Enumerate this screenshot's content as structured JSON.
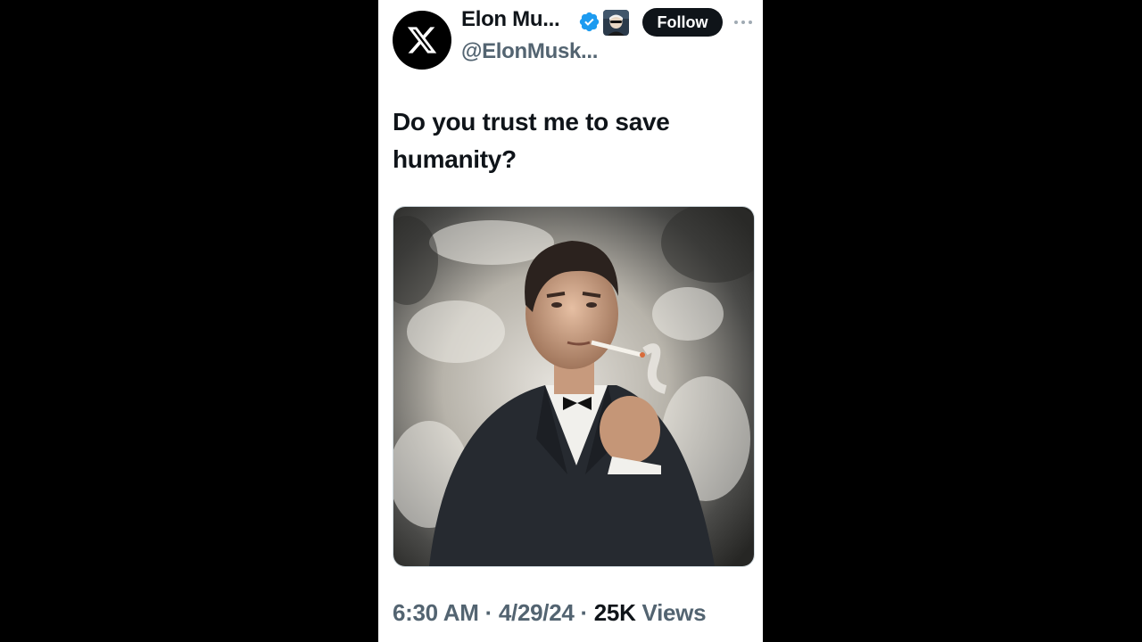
{
  "author": {
    "display_name": "Elon Mu...",
    "handle": "@ElonMusk...",
    "avatar_icon": "x-logo-icon",
    "verified_icon": "verified-badge-icon",
    "verified_color": "#1d9bf0",
    "affiliate_icon": "affiliate-badge-icon"
  },
  "actions": {
    "follow_label": "Follow",
    "more_icon": "more-horizontal-icon"
  },
  "tweet": {
    "text": "Do you trust me to save humanity?",
    "image_description": "",
    "time": "6:30 AM",
    "date": "4/29/24",
    "separator": "·",
    "views_count": "25K",
    "views_label": "Views"
  },
  "colors": {
    "page_background": "#000000",
    "card_background": "#ffffff",
    "primary_text": "#0f1419",
    "secondary_text": "#536471"
  }
}
